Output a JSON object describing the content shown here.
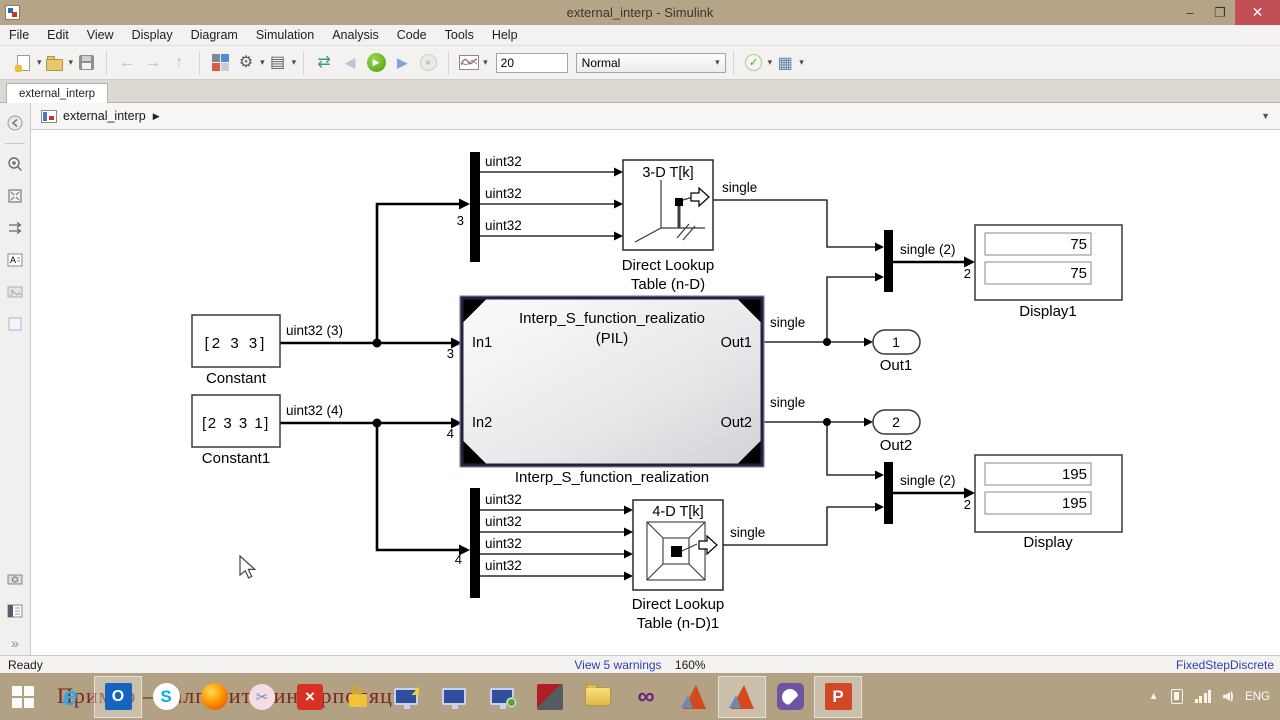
{
  "window": {
    "title": "external_interp - Simulink",
    "minimize_label": "–",
    "restore_label": "❐",
    "close_label": "✕"
  },
  "menu": {
    "items": [
      "File",
      "Edit",
      "View",
      "Display",
      "Diagram",
      "Simulation",
      "Analysis",
      "Code",
      "Tools",
      "Help"
    ]
  },
  "toolbar": {
    "stop_time": "20",
    "mode": "Normal",
    "icons": [
      "new-model",
      "open",
      "save",
      "back",
      "forward",
      "up",
      "library-browser",
      "configuration-gear",
      "model-settings",
      "update-diagram",
      "step-back",
      "run",
      "step-forward",
      "stop",
      "simulation-data-display",
      "check",
      "build"
    ]
  },
  "tabs": {
    "active": "external_interp"
  },
  "breadcrumb": {
    "model": "external_interp",
    "arrow": "▶",
    "dropdown": "▼"
  },
  "palette": {
    "icons": [
      "hide-explorer-bar",
      "zoom",
      "fit-to-view",
      "signal-routing",
      "annotation",
      "image",
      "area",
      "screenshot",
      "model-browser",
      "expand"
    ],
    "expand_glyph": "»"
  },
  "statusbar": {
    "status": "Ready",
    "warnings_link": "View 5 warnings",
    "zoom_level": "160%",
    "solver": "FixedStepDiscrete"
  },
  "taskbar": {
    "watermark": "Пример — алгоритм интерполяции",
    "language": "ENG",
    "icons": [
      "start",
      "internet-explorer",
      "outlook",
      "skype",
      "firefox",
      "snipping-tool",
      "red-x-app",
      "lock",
      "pc-transfer",
      "pc-remote",
      "pc-green",
      "dark-red-app",
      "file-explorer",
      "visual-studio",
      "matlab",
      "matlab-active",
      "purple-app",
      "powerpoint",
      "tray-expand",
      "tray-power",
      "tray-network",
      "tray-volume"
    ]
  },
  "diagram": {
    "constant": {
      "value": "[2 3 3]",
      "name": "Constant",
      "signal": "uint32 (3)"
    },
    "constant1": {
      "value": "[2 3 3 1]",
      "name": "Constant1",
      "signal": "uint32 (4)"
    },
    "demux_top": {
      "port": "3",
      "out1": "uint32",
      "out2": "uint32",
      "out3": "uint32"
    },
    "demux_bottom": {
      "port": "4",
      "out1": "uint32",
      "out2": "uint32",
      "out3": "uint32",
      "out4": "uint32"
    },
    "lookup3d": {
      "title": "3-D T[k]",
      "signal": "single",
      "name1": "Direct Lookup",
      "name2": "Table (n-D)"
    },
    "lookup4d": {
      "title": "4-D T[k]",
      "signal": "single",
      "name1": "Direct Lookup",
      "name2": "Table (n-D)1"
    },
    "sfunction": {
      "title1": "Interp_S_function_realizatio",
      "title2": "(PIL)",
      "in1": "In1",
      "in2": "In2",
      "out1": "Out1",
      "out2": "Out2",
      "in1_width": "3",
      "in2_width": "4",
      "out1_signal": "single",
      "out2_signal": "single",
      "name": "Interp_S_function_realization"
    },
    "mux_top": {
      "signal": "single (2)",
      "width": "2"
    },
    "mux_bottom": {
      "signal": "single (2)",
      "width": "2"
    },
    "display1": {
      "value1": "75",
      "value2": "75",
      "name": "Display1"
    },
    "display": {
      "value1": "195",
      "value2": "195",
      "name": "Display"
    },
    "out1": {
      "value": "1",
      "name": "Out1"
    },
    "out2": {
      "value": "2",
      "name": "Out2"
    }
  }
}
